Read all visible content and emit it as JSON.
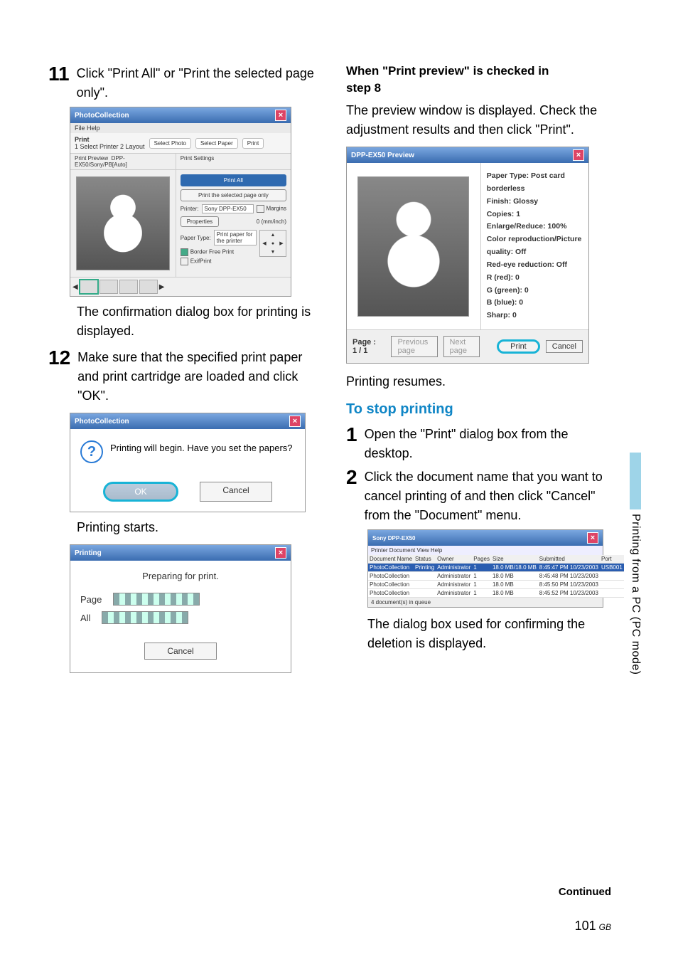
{
  "sidebar_label": "Printing from a PC (PC mode)",
  "continued": "Continued",
  "page_number": "101",
  "page_suffix": "GB",
  "left": {
    "step11_num": "11",
    "step11_text": "Click \"Print All\" or \"Print the selected page only\".",
    "after11": "The confirmation dialog box for printing is displayed.",
    "step12_num": "12",
    "step12_text": "Make sure that the specified print paper and print cartridge are loaded and click \"OK\".",
    "printing_starts": "Printing starts."
  },
  "right": {
    "heading1_a": "When \"Print preview\" is checked in",
    "heading1_b": "step 8",
    "para1": "The preview window is displayed. Check the adjustment results and then click \"Print\".",
    "resumes": "Printing resumes.",
    "stop_heading": "To stop printing",
    "s1_num": "1",
    "s1_text": "Open the \"Print\" dialog box from the desktop.",
    "s2_num": "2",
    "s2_text": "Click the document name that you want to cancel printing of and then click \"Cancel\" from the \"Document\" menu.",
    "after_s2": "The dialog box used for confirming the deletion is displayed."
  },
  "mock_photocoll": {
    "title": "PhotoCollection",
    "menu": "File  Help",
    "crumb_label": "Print",
    "crumb_steps": "1 Select Printer  2 Layout",
    "tool_select_photo": "Select Photo",
    "tool_select_paper": "Select Paper",
    "tool_print": "Print",
    "pane_label": "Print Preview",
    "pane_path": "DPP-EX50/Sony/PB[Auto]",
    "pane_settings": "Print Settings",
    "btn_print_all": "Print All",
    "btn_print_sel": "Print the selected page only",
    "lbl_printer": "Printer:",
    "printer_value": "Sony DPP-EX50",
    "btn_props": "Properties",
    "chk_margins": "Margins",
    "margins_val": "0 (mm/inch)",
    "lbl_paper": "Paper Type:",
    "paper_value": "Print paper for the printer",
    "chk_border": "Border Free Print",
    "chk_exif": "ExifPrint"
  },
  "mock_confirm": {
    "title": "PhotoCollection",
    "msg": "Printing will begin.  Have you set the papers?",
    "ok": "OK",
    "cancel": "Cancel"
  },
  "mock_prog": {
    "title": "Printing",
    "msg": "Preparing for print.",
    "row_page": "Page",
    "row_all": "All",
    "cancel": "Cancel"
  },
  "mock_prev": {
    "title": "DPP-EX50 Preview",
    "paper": "Paper Type: Post card borderless",
    "finish": "Finish: Glossy",
    "copies": "Copies: 1",
    "enlarge": "Enlarge/Reduce: 100%",
    "colorrep": "Color reproduction/Picture quality: Off",
    "redeye": "Red-eye reduction: Off",
    "r": "R (red): 0",
    "g": "G (green): 0",
    "b": "B (blue): 0",
    "sharp": "Sharp: 0",
    "page": "Page : 1 / 1",
    "prev_btn": "Previous page",
    "next_btn": "Next page",
    "print_btn": "Print",
    "cancel_btn": "Cancel"
  },
  "mock_spool": {
    "title": "Sony DPP-EX50",
    "menubar": "Printer  Document  View  Help",
    "headers": [
      "Document Name",
      "Status",
      "Owner",
      "Pages",
      "Size",
      "Submitted",
      "Port"
    ],
    "rows": [
      {
        "name": "PhotoCollection",
        "status": "Printing",
        "owner": "Administrator",
        "pages": "1",
        "size": "18.0 MB/18.0 MB",
        "submitted": "8:45:47 PM 10/23/2003",
        "port": "USB001"
      },
      {
        "name": "PhotoCollection",
        "status": "",
        "owner": "Administrator",
        "pages": "1",
        "size": "18.0 MB",
        "submitted": "8:45:48 PM 10/23/2003",
        "port": ""
      },
      {
        "name": "PhotoCollection",
        "status": "",
        "owner": "Administrator",
        "pages": "1",
        "size": "18.0 MB",
        "submitted": "8:45:50 PM 10/23/2003",
        "port": ""
      },
      {
        "name": "PhotoCollection",
        "status": "",
        "owner": "Administrator",
        "pages": "1",
        "size": "18.0 MB",
        "submitted": "8:45:52 PM 10/23/2003",
        "port": ""
      }
    ],
    "status": "4 document(s) in queue"
  }
}
